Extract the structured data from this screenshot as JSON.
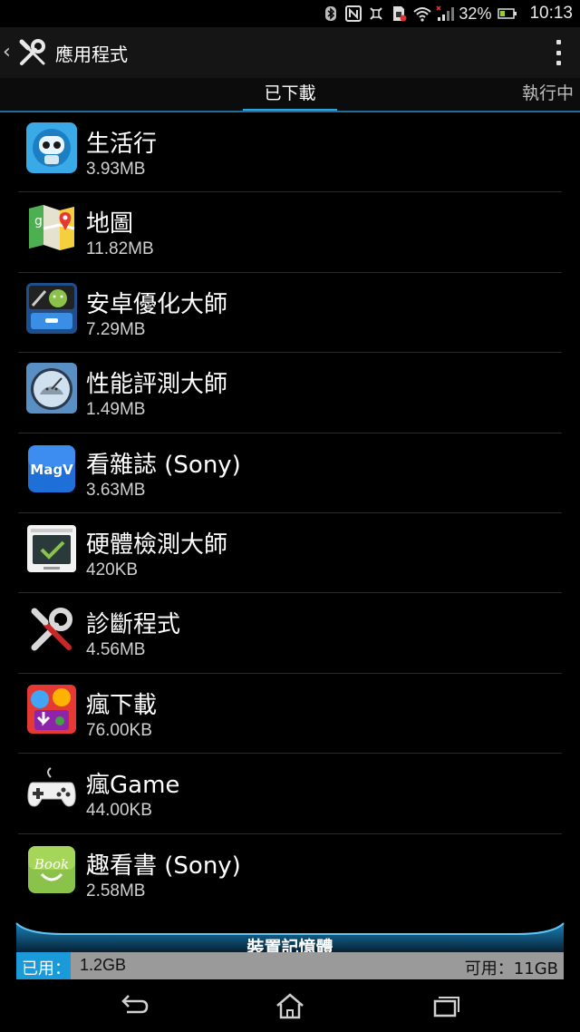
{
  "status_bar": {
    "battery_percent": "32%",
    "time": "10:13",
    "icons": [
      "bluetooth-icon",
      "nfc-icon",
      "vibrate-icon",
      "sim-icon",
      "wifi-icon",
      "signal-icon",
      "battery-icon"
    ]
  },
  "action_bar": {
    "title": "應用程式",
    "icon": "wrench-screwdriver-icon",
    "overflow_icon": "overflow-menu-icon"
  },
  "tabs": [
    {
      "label": "已下載",
      "selected": true
    },
    {
      "label": "執行中",
      "selected": false
    }
  ],
  "apps": [
    {
      "name": "生活行",
      "size": "3.93MB",
      "icon": "robot-life-icon"
    },
    {
      "name": "地圖",
      "size": "11.82MB",
      "icon": "maps-icon"
    },
    {
      "name": "安卓優化大師",
      "size": "7.29MB",
      "icon": "optimizer-icon"
    },
    {
      "name": "性能評測大師",
      "size": "1.49MB",
      "icon": "benchmark-icon"
    },
    {
      "name": "看雜誌 (Sony)",
      "size": "3.63MB",
      "icon": "magazine-icon"
    },
    {
      "name": "硬體檢測大師",
      "size": "420KB",
      "icon": "hardware-check-icon"
    },
    {
      "name": "診斷程式",
      "size": "4.56MB",
      "icon": "diagnostic-icon"
    },
    {
      "name": "瘋下載",
      "size": "76.00KB",
      "icon": "download-icon"
    },
    {
      "name": "瘋Game",
      "size": "44.00KB",
      "icon": "gamepad-icon"
    },
    {
      "name": "趣看書 (Sony)",
      "size": "2.58MB",
      "icon": "book-icon"
    }
  ],
  "storage": {
    "title": "裝置記憶體",
    "used_label": "已用：",
    "used_value": "1.2GB",
    "free_text": "可用：11GB",
    "used_fraction": 0.1
  },
  "nav": {
    "back": "back-icon",
    "home": "home-icon",
    "recent": "recent-apps-icon"
  },
  "colors": {
    "accent": "#2aa5e0",
    "used_bar": "#1a9ad8",
    "free_bar": "#9a9a9a"
  }
}
